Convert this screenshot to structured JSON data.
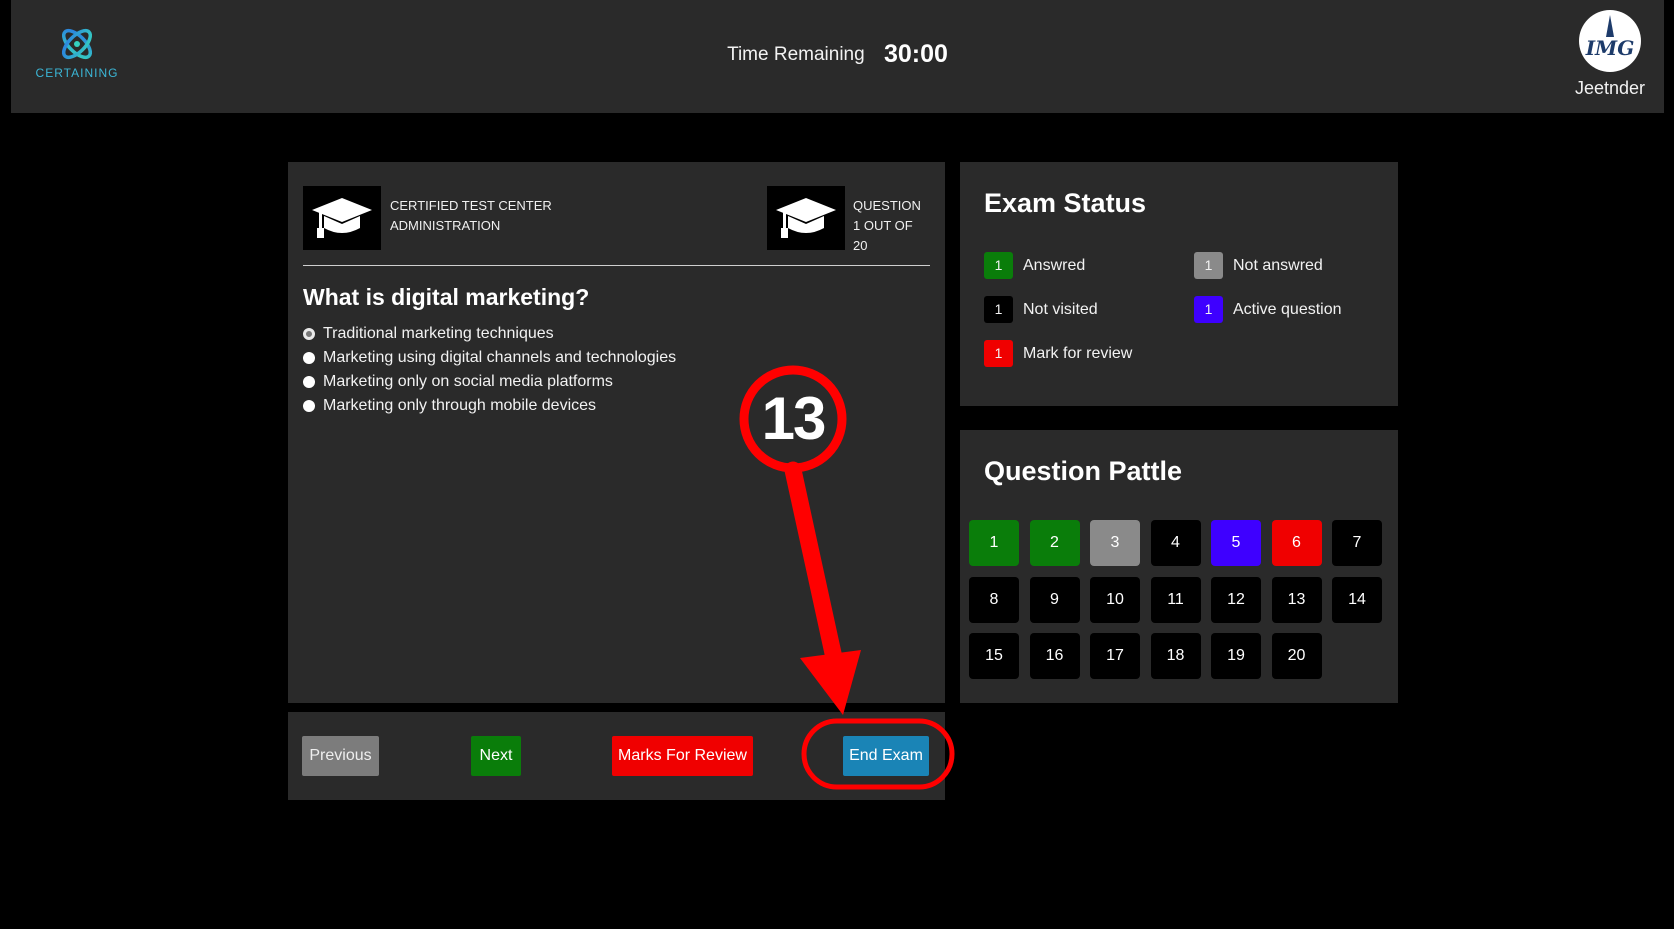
{
  "header": {
    "logo_text": "CERTAINING",
    "timer_label": "Time Remaining",
    "timer_value": "30:00",
    "user_avatar_text": "IMG",
    "username": "Jeetnder"
  },
  "question_panel": {
    "center_label_line1": "CERTIFIED TEST CENTER",
    "center_label_line2": "ADMINISTRATION",
    "question_label_line1": "QUESTION",
    "question_label_line2": "1 OUT OF 20",
    "question_text": "What is digital marketing?",
    "options": [
      "Traditional marketing techniques",
      "Marketing using digital channels and technologies",
      "Marketing only on social media platforms",
      "Marketing only through mobile devices"
    ],
    "selected_option_index": 0
  },
  "actions": {
    "previous_label": "Previous",
    "next_label": "Next",
    "review_label": "Marks For Review",
    "end_label": "End Exam"
  },
  "exam_status": {
    "title": "Exam Status",
    "legend": [
      {
        "chip": "1",
        "label": "Answred",
        "color": "#0a7d0a"
      },
      {
        "chip": "1",
        "label": "Not answred",
        "color": "#8a8a8a"
      },
      {
        "chip": "1",
        "label": "Not visited",
        "color": "#000000"
      },
      {
        "chip": "1",
        "label": "Active question",
        "color": "#3e00ff"
      },
      {
        "chip": "1",
        "label": "Mark for review",
        "color": "#f00000"
      }
    ]
  },
  "palette": {
    "title": "Question Pattle",
    "questions": [
      {
        "num": "1",
        "state": "answered"
      },
      {
        "num": "2",
        "state": "answered"
      },
      {
        "num": "3",
        "state": "not-answered"
      },
      {
        "num": "4",
        "state": "not-visited"
      },
      {
        "num": "5",
        "state": "active"
      },
      {
        "num": "6",
        "state": "review"
      },
      {
        "num": "7",
        "state": "not-visited"
      },
      {
        "num": "8",
        "state": "not-visited"
      },
      {
        "num": "9",
        "state": "not-visited"
      },
      {
        "num": "10",
        "state": "not-visited"
      },
      {
        "num": "11",
        "state": "not-visited"
      },
      {
        "num": "12",
        "state": "not-visited"
      },
      {
        "num": "13",
        "state": "not-visited"
      },
      {
        "num": "14",
        "state": "not-visited"
      },
      {
        "num": "15",
        "state": "not-visited"
      },
      {
        "num": "16",
        "state": "not-visited"
      },
      {
        "num": "17",
        "state": "not-visited"
      },
      {
        "num": "18",
        "state": "not-visited"
      },
      {
        "num": "19",
        "state": "not-visited"
      },
      {
        "num": "20",
        "state": "not-visited"
      }
    ]
  },
  "annotation": {
    "step_number": "13",
    "color": "#ff0000"
  }
}
